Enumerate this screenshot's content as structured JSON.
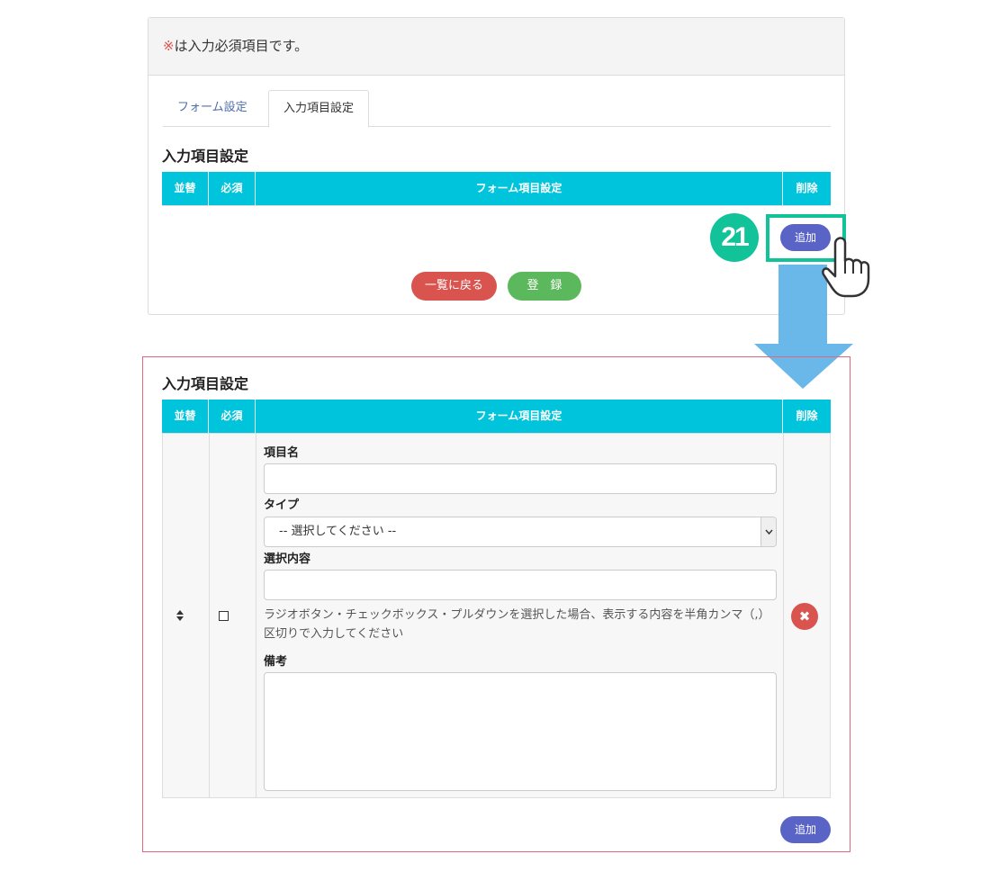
{
  "notice": {
    "mark": "※",
    "text": "は入力必須項目です。"
  },
  "tabs": [
    {
      "label": "フォーム設定",
      "active": false
    },
    {
      "label": "入力項目設定",
      "active": true
    }
  ],
  "section_title": "入力項目設定",
  "table_headers": {
    "sort": "並替",
    "required": "必須",
    "form_item": "フォーム項目設定",
    "delete": "削除"
  },
  "buttons": {
    "add": "追加",
    "back": "一覧に戻る",
    "register": "登　録"
  },
  "step_number": "21",
  "form_row": {
    "item_name_label": "項目名",
    "item_name_value": "",
    "type_label": "タイプ",
    "type_selected": "-- 選択してください --",
    "options_label": "選択内容",
    "options_value": "",
    "options_hint": "ラジオボタン・チェックボックス・プルダウンを選択した場合、表示する内容を半角カンマ（,）区切りで入力してください",
    "note_label": "備考",
    "note_value": "",
    "required_checked": false,
    "delete_icon": "times-icon"
  },
  "colors": {
    "header_bg": "#00c4dc",
    "add_button": "#5a63c6",
    "back_button": "#d9534f",
    "register_button": "#5cb85c",
    "highlight": "#12c39a",
    "arrow": "#6ab8ea",
    "red_frame": "#e3677b"
  }
}
